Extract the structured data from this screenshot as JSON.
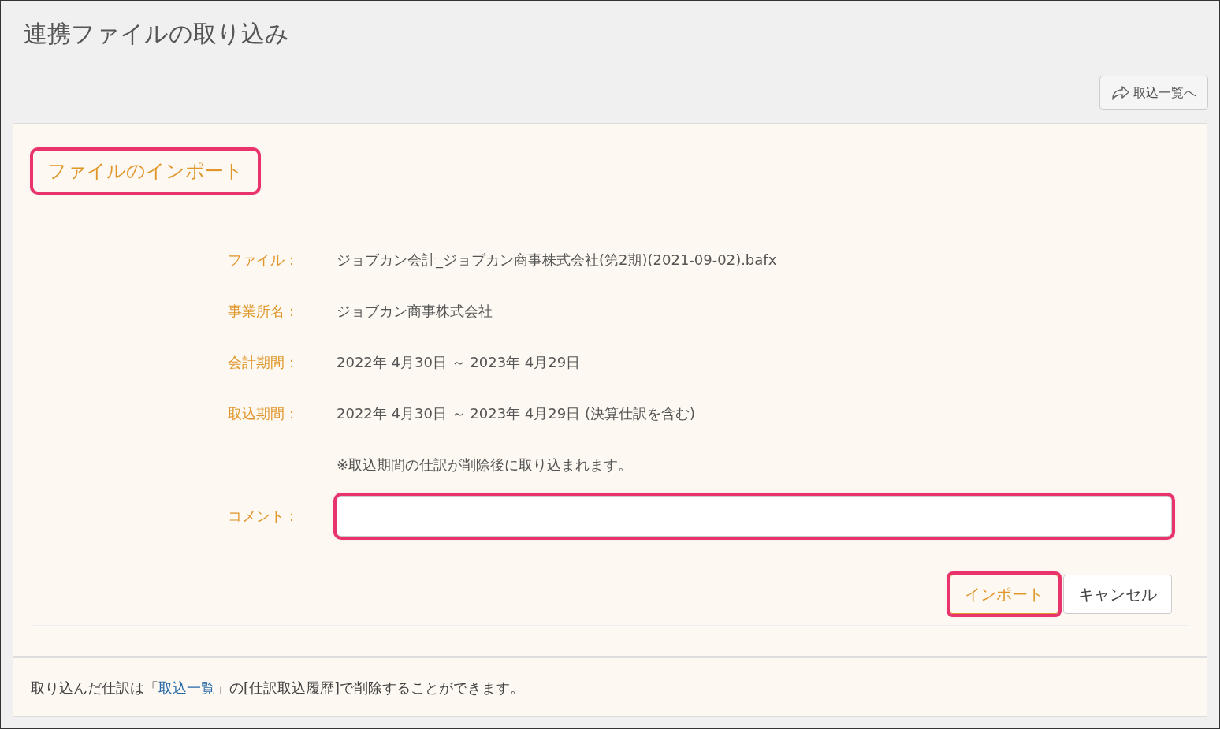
{
  "page_title": "連携ファイルの取り込み",
  "back_button": {
    "label": "取込一覧へ"
  },
  "section": {
    "title": "ファイルのインポート",
    "highlighted": true
  },
  "fields": [
    {
      "label": "ファイル：",
      "value": "ジョブカン会計_ジョブカン商事株式会社(第2期)(2021-09-02).bafx"
    },
    {
      "label": "事業所名：",
      "value": "ジョブカン商事株式会社"
    },
    {
      "label": "会計期間：",
      "value": "2022年 4月30日 ～ 2023年 4月29日"
    },
    {
      "label": "取込期間：",
      "value": "2022年 4月30日 ～ 2023年 4月29日 (決算仕訳を含む)"
    }
  ],
  "note": "※取込期間の仕訳が削除後に取り込まれます。",
  "comment": {
    "label": "コメント：",
    "highlighted": true
  },
  "buttons": [
    {
      "label": "インポート",
      "kind": "primary",
      "highlighted": true
    },
    {
      "label": "キャンセル",
      "kind": "default",
      "highlighted": false
    }
  ],
  "footer": {
    "before": "取り込んだ仕訳は「",
    "link": "取込一覧",
    "after": "」の[仕訳取込履歴]で削除することができます。"
  }
}
